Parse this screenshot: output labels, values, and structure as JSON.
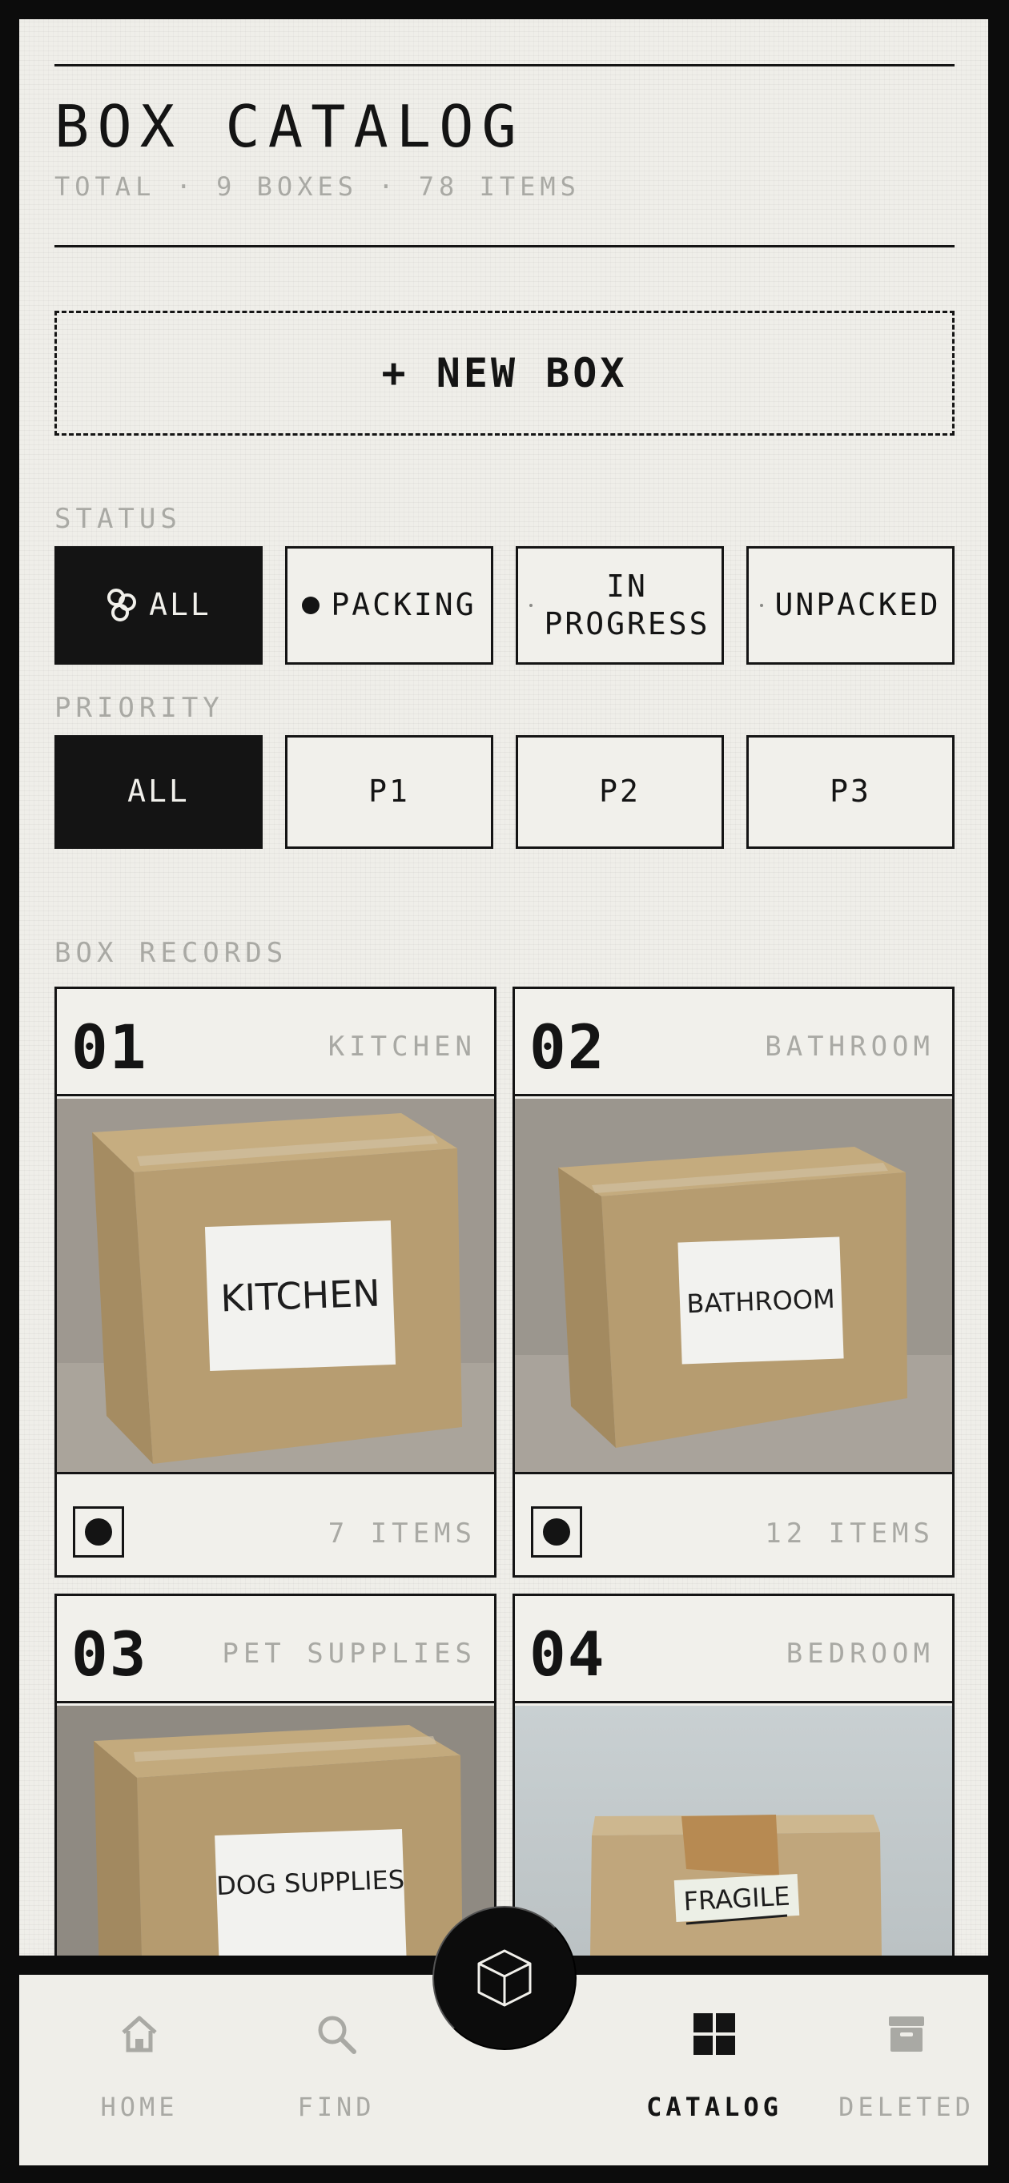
{
  "header": {
    "title": "BOX CATALOG",
    "subtitle": "TOTAL · 9 BOXES · 78 ITEMS"
  },
  "new_box_label": "+ NEW BOX",
  "status_filter": {
    "label": "STATUS",
    "options": [
      {
        "label": "ALL",
        "active": true,
        "icon": "cluster-icon"
      },
      {
        "label": "PACKING",
        "active": false,
        "icon": "dot-icon"
      },
      {
        "label": "IN\nPROGRESS",
        "active": false,
        "icon": "small-dot-icon"
      },
      {
        "label": "UNPACKED",
        "active": false,
        "icon": "small-dot-icon"
      }
    ]
  },
  "priority_filter": {
    "label": "PRIORITY",
    "options": [
      {
        "label": "ALL",
        "active": true
      },
      {
        "label": "P1",
        "active": false
      },
      {
        "label": "P2",
        "active": false
      },
      {
        "label": "P3",
        "active": false
      }
    ]
  },
  "records": {
    "label": "BOX RECORDS",
    "boxes": [
      {
        "number": "01",
        "room": "KITCHEN",
        "box_label": "KITCHEN",
        "count": "7 ITEMS",
        "checked": true
      },
      {
        "number": "02",
        "room": "BATHROOM",
        "box_label": "BATHROOM",
        "count": "12 ITEMS",
        "checked": true
      },
      {
        "number": "03",
        "room": "PET SUPPLIES",
        "box_label": "DOG SUPPLIES",
        "count": "",
        "checked": false
      },
      {
        "number": "04",
        "room": "BEDROOM",
        "box_label": "FRAGILE",
        "count": "",
        "checked": false
      }
    ]
  },
  "nav": {
    "items": [
      {
        "label": "HOME",
        "icon": "home-icon",
        "active": false
      },
      {
        "label": "FIND",
        "icon": "search-icon",
        "active": false
      },
      {
        "label": "CATALOG",
        "icon": "grid-icon",
        "active": true
      },
      {
        "label": "DELETED",
        "icon": "archive-icon",
        "active": false
      }
    ],
    "fab_icon": "cube-icon"
  },
  "colors": {
    "ink": "#141414",
    "paper": "#efeee9",
    "muted": "#a9a9a4",
    "cardboard": "#b39a6e"
  }
}
